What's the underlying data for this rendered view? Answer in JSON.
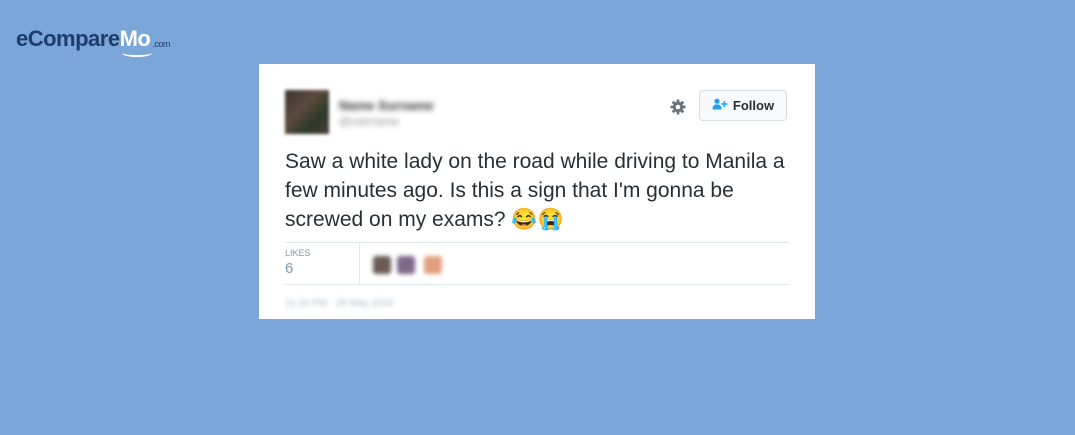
{
  "branding": {
    "logo_main": "eCompare",
    "logo_accent": "Mo",
    "logo_suffix": ".com"
  },
  "tweet": {
    "user_name": "Name Surname",
    "user_handle": "@username",
    "follow_label": "Follow",
    "text": "Saw a white lady on the road while driving to Manila a few minutes ago. Is this a sign that I'm gonna be screwed on my exams? 😂😭",
    "likes_label": "LIKES",
    "likes_count": "6",
    "timestamp": "11:24 PM - 20 May 2016"
  },
  "colors": {
    "background": "#7ba6d9",
    "card": "#ffffff",
    "text": "#292f33",
    "muted": "#8899a6",
    "follow_icon": "#1da1f2"
  },
  "icons": {
    "settings": "gear-icon",
    "follow": "add-user-icon"
  }
}
